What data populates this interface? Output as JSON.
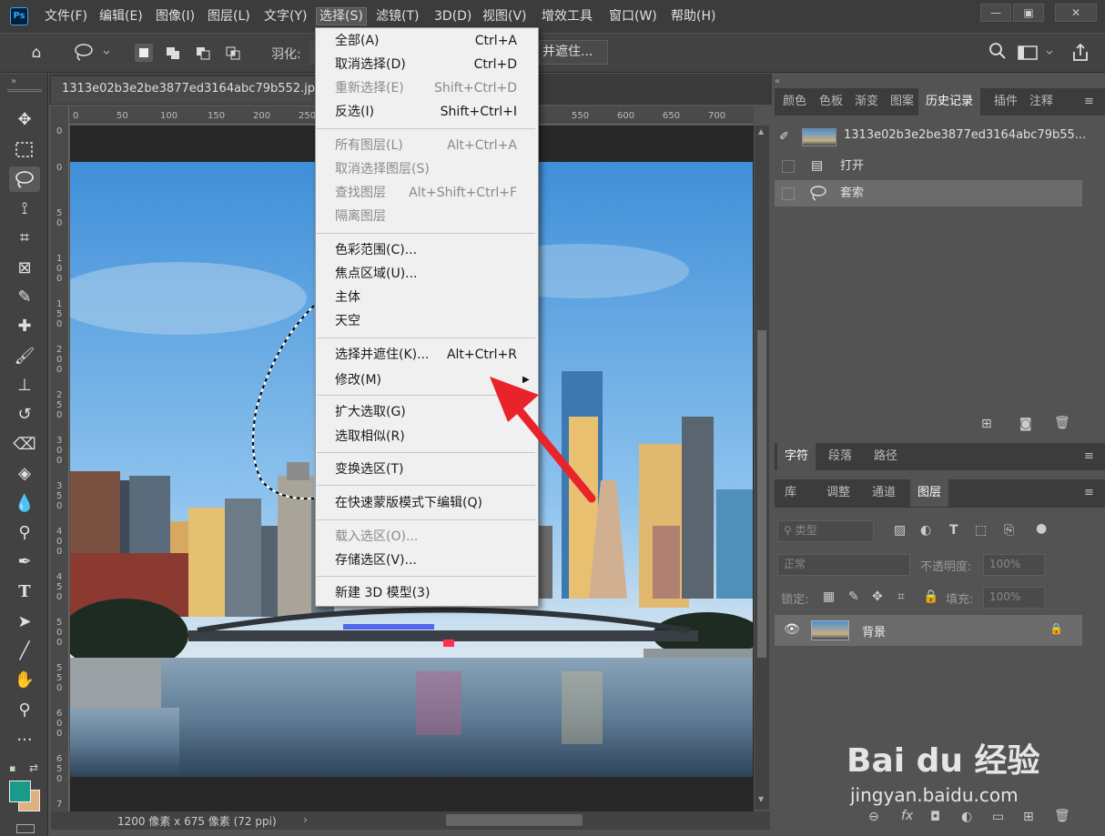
{
  "app": {
    "logo": "Ps"
  },
  "menubar": {
    "items": [
      "文件(F)",
      "编辑(E)",
      "图像(I)",
      "图层(L)",
      "文字(Y)",
      "选择(S)",
      "滤镜(T)",
      "3D(D)",
      "视图(V)",
      "增效工具",
      "窗口(W)",
      "帮助(H)"
    ],
    "window_controls": [
      "minimize",
      "restore",
      "close"
    ]
  },
  "options_bar": {
    "feather_label": "羽化:",
    "select_and_mask_label": "并遮住..."
  },
  "document": {
    "tab_title": "1313e02b3e2be3877ed3164abc79b552.jp",
    "status": "1200 像素 x 675 像素 (72 ppi)",
    "ruler_top": [
      "0",
      "50",
      "100",
      "150",
      "200",
      "250",
      "550",
      "600",
      "650",
      "700"
    ],
    "ruler_left": [
      "0",
      "0",
      "5\n0",
      "1\n0\n0",
      "1\n5\n0",
      "2\n0\n0",
      "2\n5\n0",
      "3\n0\n0",
      "3\n5\n0",
      "4\n0\n0",
      "4\n5\n0",
      "5\n0\n0",
      "5\n5\n0",
      "6\n0\n0",
      "6\n5\n0",
      "7"
    ]
  },
  "select_menu": {
    "groups": [
      [
        {
          "label": "全部(A)",
          "shortcut": "Ctrl+A",
          "disabled": false
        },
        {
          "label": "取消选择(D)",
          "shortcut": "Ctrl+D",
          "disabled": false
        },
        {
          "label": "重新选择(E)",
          "shortcut": "Shift+Ctrl+D",
          "disabled": true
        },
        {
          "label": "反选(I)",
          "shortcut": "Shift+Ctrl+I",
          "disabled": false
        }
      ],
      [
        {
          "label": "所有图层(L)",
          "shortcut": "Alt+Ctrl+A",
          "disabled": true
        },
        {
          "label": "取消选择图层(S)",
          "shortcut": "",
          "disabled": true
        },
        {
          "label": "查找图层",
          "shortcut": "Alt+Shift+Ctrl+F",
          "disabled": true
        },
        {
          "label": "隔离图层",
          "shortcut": "",
          "disabled": true
        }
      ],
      [
        {
          "label": "色彩范围(C)...",
          "shortcut": "",
          "disabled": false
        },
        {
          "label": "焦点区域(U)...",
          "shortcut": "",
          "disabled": false
        },
        {
          "label": "主体",
          "shortcut": "",
          "disabled": false
        },
        {
          "label": "天空",
          "shortcut": "",
          "disabled": false
        }
      ],
      [
        {
          "label": "选择并遮住(K)...",
          "shortcut": "Alt+Ctrl+R",
          "disabled": false
        },
        {
          "label": "修改(M)",
          "shortcut": "",
          "disabled": false,
          "submenu": true
        }
      ],
      [
        {
          "label": "扩大选取(G)",
          "shortcut": "",
          "disabled": false
        },
        {
          "label": "选取相似(R)",
          "shortcut": "",
          "disabled": false
        }
      ],
      [
        {
          "label": "变换选区(T)",
          "shortcut": "",
          "disabled": false
        }
      ],
      [
        {
          "label": "在快速蒙版模式下编辑(Q)",
          "shortcut": "",
          "disabled": false
        }
      ],
      [
        {
          "label": "载入选区(O)...",
          "shortcut": "",
          "disabled": true
        },
        {
          "label": "存储选区(V)...",
          "shortcut": "",
          "disabled": false
        }
      ],
      [
        {
          "label": "新建 3D 模型(3)",
          "shortcut": "",
          "disabled": false
        }
      ]
    ]
  },
  "panels": {
    "top_tabs": [
      "颜色",
      "色板",
      "渐变",
      "图案",
      "历史记录",
      "插件",
      "注释"
    ],
    "top_active": "历史记录",
    "history": {
      "snapshot": "1313e02b3e2be3877ed3164abc79b55...",
      "steps": [
        "打开",
        "套索"
      ]
    },
    "mid_tabs": [
      "字符",
      "段落",
      "路径"
    ],
    "mid_active": "字符",
    "layer_tabs": [
      "库",
      "调整",
      "通道",
      "图层"
    ],
    "layer_active": "图层",
    "layers": {
      "filter_kind": "类型",
      "blend_mode": "正常",
      "opacity_label": "不透明度:",
      "opacity_value": "100%",
      "lock_label": "锁定:",
      "fill_label": "填充:",
      "fill_value": "100%",
      "items": [
        {
          "name": "背景",
          "visible": true,
          "locked": true
        }
      ]
    }
  },
  "watermark": {
    "brand": "Bai du 经验",
    "url": "jingyan.baidu.com"
  },
  "colors": {
    "foreground": "#1a9a8a",
    "background": "#e0b080",
    "menu_bg": "#f0f0f0",
    "arrow": "#e8232a"
  }
}
